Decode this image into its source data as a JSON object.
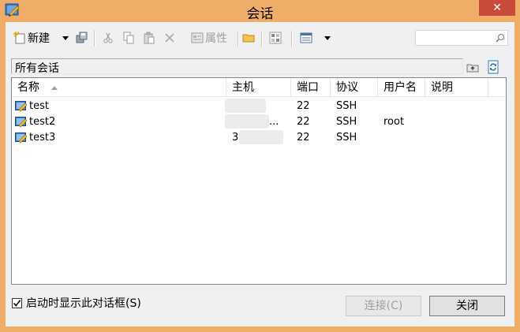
{
  "window": {
    "title": "会话",
    "close_symbol": "✕"
  },
  "toolbar": {
    "new_label": "新建",
    "properties_label": "属性",
    "search_placeholder": ""
  },
  "folder_bar": {
    "path": "所有会话"
  },
  "list": {
    "columns": [
      "名称",
      "主机",
      "端口",
      "协议",
      "用户名",
      "说明"
    ],
    "rows": [
      {
        "name": "test",
        "host": "",
        "port": "22",
        "protocol": "SSH",
        "user": "",
        "desc": ""
      },
      {
        "name": "test2",
        "host": "...",
        "port": "22",
        "protocol": "SSH",
        "user": "root",
        "desc": ""
      },
      {
        "name": "test3",
        "host": "3",
        "port": "22",
        "protocol": "SSH",
        "user": "",
        "desc": ""
      }
    ]
  },
  "footer": {
    "startup_checkbox_label": "启动时显示此对话框(S)",
    "startup_checked": true,
    "connect_label": "连接(C)",
    "close_label": "关闭"
  },
  "colors": {
    "frame": "#f0ad68",
    "close_button": "#c74b3b",
    "client_bg": "#f0f0f0"
  }
}
